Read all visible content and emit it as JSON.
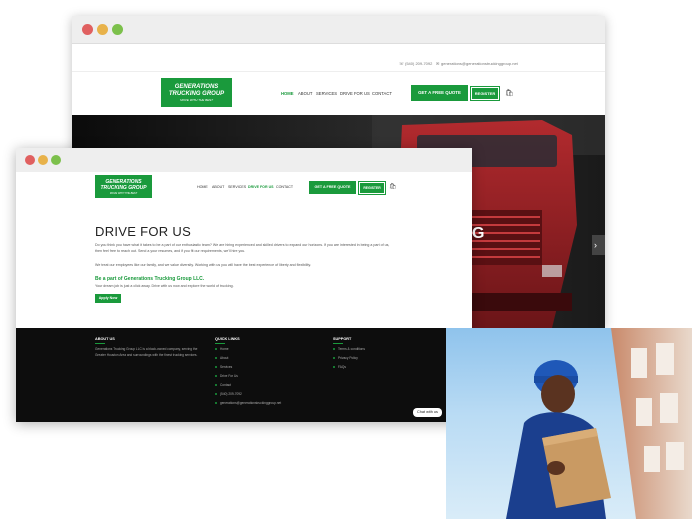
{
  "window_back": {
    "top_strip": {
      "phone": "(540) 209-7092",
      "email": "generations@generationstruckinggroup.net"
    },
    "logo": {
      "line1": "GENERATIONS",
      "line2": "TRUCKING GROUP",
      "tagline": "MOVE WITH THE BEST"
    },
    "nav": [
      "HOME",
      "ABOUT",
      "SERVICES",
      "DRIVE FOR US",
      "CONTACT"
    ],
    "quote_button": "GET A FREE QUOTE",
    "register_button": "REGISTER",
    "hero_text": "G"
  },
  "window_front": {
    "logo": {
      "line1": "GENERATIONS",
      "line2": "TRUCKING GROUP",
      "tagline": "MOVE WITH THE BEST"
    },
    "nav": [
      "HOME",
      "ABOUT",
      "SERVICES",
      "DRIVE FOR US",
      "CONTACT"
    ],
    "quote_button": "GET A FREE QUOTE",
    "register_button": "REGISTER",
    "page_title": "DRIVE FOR US",
    "intro": "Do you think you have what it takes to be a part of our enthusiastic team? We are hiring experienced and skilled drivers to expand our horizons. If you are interested in being a part of us, then feel free to reach out. Send a your resumes, and if you fit our requirements, we'll hire you.",
    "intro2": "We treat our employees like our family, and we value diversity. Working with us you will have the best experience of liberty and flexibility.",
    "subheading": "Be a part of Generations Trucking Group LLC.",
    "subtext": "Your dream job is just a click away. Drive with us now and explore the world of trucking.",
    "apply_button": "Apply Now",
    "footer": {
      "about_heading": "ABOUT US",
      "about_text_1": "Generations Trucking Group LLC is a black-owned company, serving the",
      "about_text_2": "Greater Houston Area and surroundings with the finest trucking services.",
      "quick_heading": "QUICK LINKS",
      "quick_links": [
        "Home",
        "About",
        "Services",
        "Drive For Us",
        "Contact",
        "(540) 209-7092",
        "generations@generationstruckinggroup.net"
      ],
      "support_heading": "SUPPORT",
      "support_links": [
        "Terms & conditions",
        "Privacy Policy",
        "FAQs"
      ],
      "chat": "Chat with us"
    }
  },
  "colors": {
    "brand_green": "#1a9a3c",
    "footer_bg": "#0d0d0d",
    "dot_red": "#e06060",
    "dot_yellow": "#e8b24a",
    "dot_green": "#7cc04b"
  }
}
